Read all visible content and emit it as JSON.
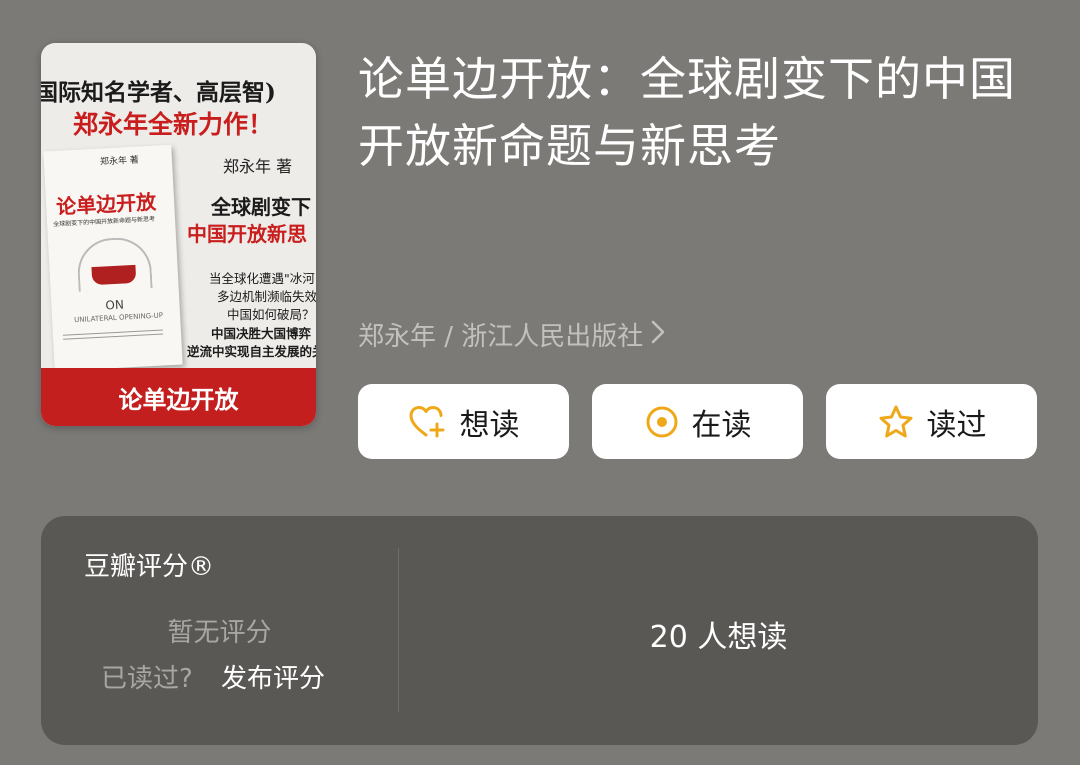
{
  "book": {
    "title": "论单边开放：全球剧变下的中国开放新命题与新思考",
    "meta": "郑永年 / 浙江人民出版社",
    "cover": {
      "line1": "国际知名学者、高层智)",
      "line2": "郑永年全新力作！",
      "author": "郑永年 著",
      "sub1": "全球剧变下",
      "sub2": "中国开放新思",
      "quote1": "当全球化遭遇\"冰河",
      "quote2": "多边机制濒临失效",
      "quote3": "中国如何破局？",
      "quote4": "中国决胜大国博弈",
      "quote5": "逆流中实现自主发展的关",
      "mini_author": "郑永年 著",
      "mini_title": "论单边开放",
      "mini_sub": "全球剧变下的中国开放新命题与新思考",
      "mini_on": "ON",
      "mini_on_sub": "UNILATERAL OPENING-UP",
      "band": "论单边开放"
    }
  },
  "actions": {
    "want": "想读",
    "reading": "在读",
    "read": "读过"
  },
  "icons": {
    "want": "heart-plus-icon",
    "reading": "target-circle-icon",
    "read": "star-outline-icon",
    "meta": "chevron-right-icon"
  },
  "colors": {
    "accent": "#f0a81b",
    "background": "#7b7a77",
    "panel": "#5a5854"
  },
  "rating": {
    "label": "豆瓣评分®",
    "no_rating": "暂无评分",
    "read_question": "已读过?",
    "publish": "发布评分",
    "want_count": "20 人想读"
  }
}
